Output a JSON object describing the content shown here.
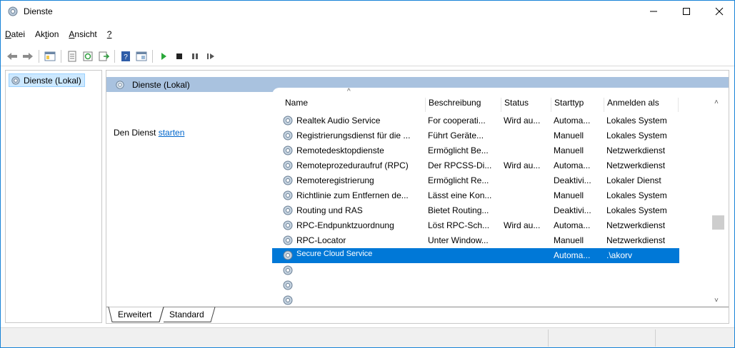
{
  "window": {
    "title": "Dienste"
  },
  "menu": [
    {
      "id": "datei",
      "pre": "",
      "ul": "D",
      "post": "atei"
    },
    {
      "id": "aktion",
      "pre": "Ak",
      "ul": "t",
      "post": "ion"
    },
    {
      "id": "ansicht",
      "pre": "",
      "ul": "A",
      "post": "nsicht"
    },
    {
      "id": "hilfe",
      "pre": "",
      "ul": "?",
      "post": ""
    }
  ],
  "tree": {
    "item_label": "Dienste (Lokal)"
  },
  "pane": {
    "header_title": "Dienste (Lokal)",
    "description_prefix": "Den Dienst ",
    "description_link": "starten"
  },
  "list": {
    "columns": [
      "Name",
      "Beschreibung",
      "Status",
      "Starttyp",
      "Anmelden als"
    ],
    "rows": [
      {
        "name": "Realtek Audio Service",
        "desc": "For cooperati...",
        "status": "Wird au...",
        "start": "Automa...",
        "logon": "Lokales System"
      },
      {
        "name": "Registrierungsdienst für die ...",
        "desc": "Führt Geräte...",
        "status": "",
        "start": "Manuell",
        "logon": "Lokales System"
      },
      {
        "name": "Remotedesktopdienste",
        "desc": "Ermöglicht Be...",
        "status": "",
        "start": "Manuell",
        "logon": "Netzwerkdienst"
      },
      {
        "name": "Remoteprozeduraufruf (RPC)",
        "desc": "Der RPCSS-Di...",
        "status": "Wird au...",
        "start": "Automa...",
        "logon": "Netzwerkdienst"
      },
      {
        "name": "Remoteregistrierung",
        "desc": "Ermöglicht Re...",
        "status": "",
        "start": "Deaktivi...",
        "logon": "Lokaler Dienst"
      },
      {
        "name": "Richtlinie zum Entfernen de...",
        "desc": "Lässt eine Kon...",
        "status": "",
        "start": "Manuell",
        "logon": "Lokales System"
      },
      {
        "name": "Routing und RAS",
        "desc": "Bietet Routing...",
        "status": "",
        "start": "Deaktivi...",
        "logon": "Lokales System"
      },
      {
        "name": "RPC-Endpunktzuordnung",
        "desc": "Löst RPC-Sch...",
        "status": "Wird au...",
        "start": "Automa...",
        "logon": "Netzwerkdienst"
      },
      {
        "name": "RPC-Locator",
        "desc": "Unter Window...",
        "status": "",
        "start": "Manuell",
        "logon": "Netzwerkdienst"
      },
      {
        "name": "Secure Cloud Service",
        "desc": "",
        "status": "",
        "start": "Automa...",
        "logon": ".\\akorv",
        "selected": true
      },
      {
        "name": "",
        "desc": "",
        "status": "",
        "start": "",
        "logon": ""
      },
      {
        "name": "",
        "desc": "",
        "status": "",
        "start": "",
        "logon": ""
      },
      {
        "name": "",
        "desc": "",
        "status": "",
        "start": "",
        "logon": ""
      }
    ]
  },
  "tabs": {
    "extended": "Erweitert",
    "standard": "Standard"
  },
  "colors": {
    "selection": "#0078d7",
    "header": "#a9c2df"
  }
}
